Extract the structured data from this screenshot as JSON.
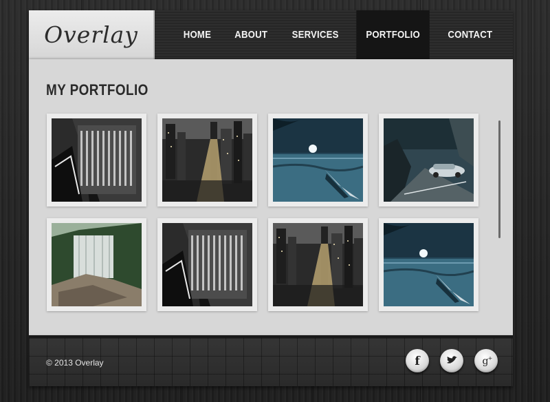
{
  "site": {
    "logo": "Overlay"
  },
  "nav": {
    "items": [
      {
        "label": "HOME"
      },
      {
        "label": "ABOUT"
      },
      {
        "label": "SERVICES"
      },
      {
        "label": "PORTFOLIO"
      },
      {
        "label": "CONTACT"
      }
    ],
    "active": "PORTFOLIO"
  },
  "main": {
    "title": "MY PORTFOLIO",
    "thumbnails": [
      {
        "subject": "city-buildings-aerial"
      },
      {
        "subject": "city-night-street"
      },
      {
        "subject": "moonlit-lake-boat"
      },
      {
        "subject": "sports-car-road"
      },
      {
        "subject": "waterfall"
      },
      {
        "subject": "city-buildings-aerial"
      },
      {
        "subject": "city-night-street"
      },
      {
        "subject": "moonlit-lake-boat"
      }
    ]
  },
  "footer": {
    "copyright": "© 2013 Overlay",
    "social": [
      {
        "icon": "facebook-icon",
        "glyph": "f"
      },
      {
        "icon": "twitter-icon",
        "glyph": "bird"
      },
      {
        "icon": "google-plus-icon",
        "glyph": "g+"
      }
    ]
  },
  "colors": {
    "header_bg": "#2a2a2a",
    "nav_active_bg": "#151515",
    "panel_bg": "#d7d7d7",
    "footer_bg": "#303030"
  }
}
